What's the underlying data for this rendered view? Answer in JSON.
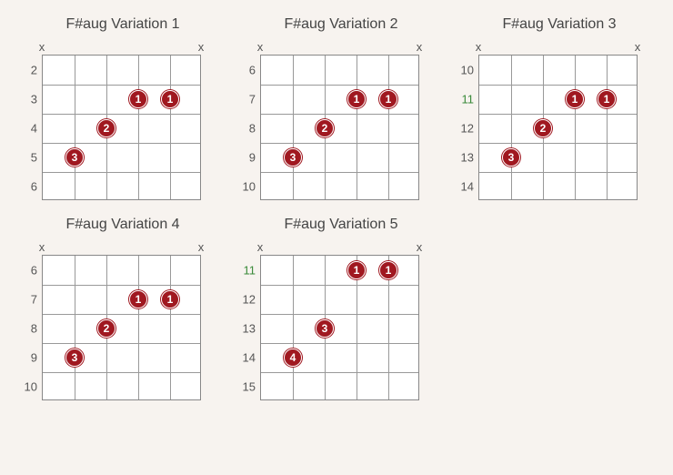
{
  "chart_data": [
    {
      "title": "F#aug Variation 1",
      "type": "chord-diagram",
      "strings": 6,
      "frets_shown": [
        2,
        3,
        4,
        5,
        6
      ],
      "root_fret_index": null,
      "mutes": [
        1,
        6
      ],
      "dots": [
        {
          "string": 4,
          "fret": 3,
          "finger": "1"
        },
        {
          "string": 5,
          "fret": 3,
          "finger": "1"
        },
        {
          "string": 3,
          "fret": 4,
          "finger": "2"
        },
        {
          "string": 2,
          "fret": 5,
          "finger": "3"
        }
      ]
    },
    {
      "title": "F#aug Variation 2",
      "type": "chord-diagram",
      "strings": 6,
      "frets_shown": [
        6,
        7,
        8,
        9,
        10
      ],
      "root_fret_index": null,
      "mutes": [
        1,
        6
      ],
      "dots": [
        {
          "string": 4,
          "fret": 7,
          "finger": "1"
        },
        {
          "string": 5,
          "fret": 7,
          "finger": "1"
        },
        {
          "string": 3,
          "fret": 8,
          "finger": "2"
        },
        {
          "string": 2,
          "fret": 9,
          "finger": "3"
        }
      ]
    },
    {
      "title": "F#aug Variation 3",
      "type": "chord-diagram",
      "strings": 6,
      "frets_shown": [
        10,
        11,
        12,
        13,
        14
      ],
      "root_fret_index": 1,
      "mutes": [
        1,
        6
      ],
      "dots": [
        {
          "string": 4,
          "fret": 11,
          "finger": "1"
        },
        {
          "string": 5,
          "fret": 11,
          "finger": "1"
        },
        {
          "string": 3,
          "fret": 12,
          "finger": "2"
        },
        {
          "string": 2,
          "fret": 13,
          "finger": "3"
        }
      ]
    },
    {
      "title": "F#aug Variation 4",
      "type": "chord-diagram",
      "strings": 6,
      "frets_shown": [
        6,
        7,
        8,
        9,
        10
      ],
      "root_fret_index": null,
      "mutes": [
        1,
        6
      ],
      "dots": [
        {
          "string": 4,
          "fret": 7,
          "finger": "1"
        },
        {
          "string": 5,
          "fret": 7,
          "finger": "1"
        },
        {
          "string": 3,
          "fret": 8,
          "finger": "2"
        },
        {
          "string": 2,
          "fret": 9,
          "finger": "3"
        }
      ]
    },
    {
      "title": "F#aug Variation 5",
      "type": "chord-diagram",
      "strings": 6,
      "frets_shown": [
        11,
        12,
        13,
        14,
        15
      ],
      "root_fret_index": 0,
      "mutes": [
        1,
        6
      ],
      "dots": [
        {
          "string": 4,
          "fret": 11,
          "finger": "1"
        },
        {
          "string": 5,
          "fret": 11,
          "finger": "1"
        },
        {
          "string": 3,
          "fret": 13,
          "finger": "3"
        },
        {
          "string": 2,
          "fret": 14,
          "finger": "4"
        }
      ]
    }
  ],
  "colors": {
    "dot": "#a01820",
    "root_highlight": "#3a8a3a"
  },
  "mute_symbol": "x"
}
